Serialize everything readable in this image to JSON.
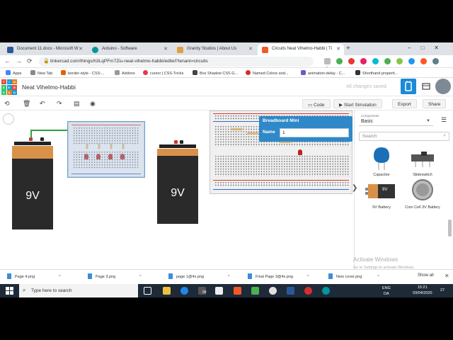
{
  "browser": {
    "tabs": [
      {
        "label": "Document 11.docx - Microsoft W",
        "icon_color": "#2b579a"
      },
      {
        "label": "Arduino - Software",
        "icon_color": "#00979d"
      },
      {
        "label": "Granity Studios | About Us",
        "icon_color": "#e0a040"
      },
      {
        "label": "Circuits Neat Vihelmo-Habbi | Ti",
        "icon_color": "#f05a28"
      }
    ],
    "url": "tinkercad.com/things/h3LqPFm7Ziu-neat-vihelmo-habbi/editel?tenant=circuits",
    "bookmarks": [
      {
        "label": "Apps",
        "color": "#4285f4"
      },
      {
        "label": "New Tab",
        "color": "#888888"
      },
      {
        "label": "border-style - CSS:...",
        "color": "#e66000"
      },
      {
        "label": "Addons",
        "color": "#999999"
      },
      {
        "label": "cursor | CSS-Tricks",
        "color": "#e63946"
      },
      {
        "label": "Box Shadow CSS G...",
        "color": "#444444"
      },
      {
        "label": "Named Colors and...",
        "color": "#d03030"
      },
      {
        "label": "animation-delay - C...",
        "color": "#6a5acd"
      },
      {
        "label": "Shorthand properti...",
        "color": "#333333"
      }
    ]
  },
  "app": {
    "logo_letters": [
      "T",
      "I",
      "N",
      "K",
      "E",
      "R",
      "C",
      "A",
      "D"
    ],
    "logo_colors": [
      "#e74c3c",
      "#1c9ad6",
      "#e67e22",
      "#2ecc71",
      "#1c9ad6",
      "#e74c3c",
      "#2ecc71",
      "#e67e22",
      "#1c9ad6"
    ],
    "project_title": "Neat Vihelmo-Habbi",
    "save_status": "All changes saved",
    "toolbar": {
      "code_label": "Code",
      "simulate_label": "Start Simulation",
      "export_label": "Export",
      "share_label": "Share"
    },
    "inspector": {
      "title": "Breadboard Mini",
      "name_label": "Name",
      "name_value": "1"
    },
    "batteries": [
      {
        "label": "9V"
      },
      {
        "label": "9V"
      }
    ],
    "panel": {
      "dropdown_caption": "Components",
      "dropdown_value": "Basic",
      "search_placeholder": "Search",
      "components": [
        {
          "label": "Capacitor"
        },
        {
          "label": "Slideswitch"
        },
        {
          "label": "9V Battery"
        },
        {
          "label": "Coin Cell 3V Battery"
        }
      ],
      "battery_icon_text": "9V"
    },
    "watermark": {
      "title": "Activate Windows",
      "subtitle": "Go to Settings to activate Windows."
    }
  },
  "downloads": {
    "items": [
      {
        "label": "Page 4.png"
      },
      {
        "label": "Page 3.png"
      },
      {
        "label": "page 1@4x.png"
      },
      {
        "label": "Final Page 3@4x.png"
      },
      {
        "label": "New cover.png"
      }
    ],
    "show_all": "Show all"
  },
  "taskbar": {
    "search_placeholder": "Type here to search",
    "tray_lang": "ENG",
    "tray_region": "DA",
    "time": "15:21",
    "date": "03/04/2020",
    "notification_count": "27",
    "badge_count": "99"
  }
}
